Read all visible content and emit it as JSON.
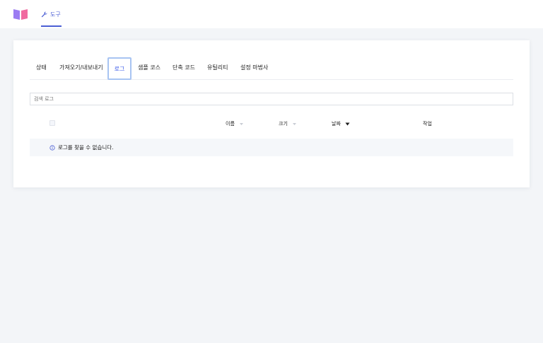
{
  "topbar": {
    "logo_icon": "book-icon",
    "tool_tab": {
      "icon": "wrench-icon",
      "label": "도구"
    }
  },
  "tabs": [
    {
      "label": "상태"
    },
    {
      "label": "가져오기/내보내기"
    },
    {
      "label": "로그",
      "active": true
    },
    {
      "label": "샘플 코스"
    },
    {
      "label": "단축 코드"
    },
    {
      "label": "유틸리티"
    },
    {
      "label": "설정 마법사"
    }
  ],
  "search": {
    "placeholder": "검색 로그",
    "value": ""
  },
  "table": {
    "columns": {
      "name": "이름",
      "size": "크기",
      "date": "날짜",
      "actions": "작업"
    },
    "sort_column": "date",
    "empty_message": "로그를 찾을 수 없습니다."
  },
  "colors": {
    "accent": "#3858e9",
    "active_outline": "#a8c4f2",
    "background": "#f3f5f8"
  }
}
